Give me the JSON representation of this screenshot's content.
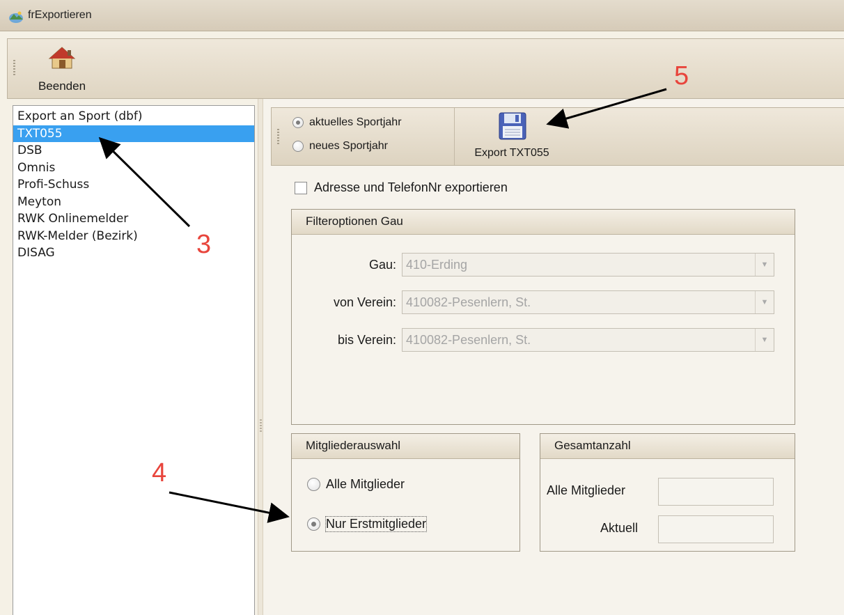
{
  "window": {
    "title": "frExportieren"
  },
  "toolbar": {
    "home_label": "Beenden"
  },
  "export_list": {
    "items": [
      {
        "label": "Export an Sport (dbf)",
        "selected": false
      },
      {
        "label": "TXT055",
        "selected": true
      },
      {
        "label": "DSB",
        "selected": false
      },
      {
        "label": "Omnis",
        "selected": false
      },
      {
        "label": "Profi-Schuss",
        "selected": false
      },
      {
        "label": "Meyton",
        "selected": false
      },
      {
        "label": "RWK Onlinemelder",
        "selected": false
      },
      {
        "label": "RWK-Melder (Bezirk)",
        "selected": false
      },
      {
        "label": "DISAG",
        "selected": false
      }
    ]
  },
  "sportjahr": {
    "current_label": "aktuelles Sportjahr",
    "new_label": "neues Sportjahr",
    "selected": "current"
  },
  "export_button": {
    "label": "Export TXT055"
  },
  "address_checkbox": {
    "label": "Adresse und TelefonNr exportieren",
    "checked": false
  },
  "filter_group": {
    "title": "Filteroptionen Gau",
    "gau_label": "Gau:",
    "gau_value": "410-Erding",
    "von_label": "von Verein:",
    "von_value": "410082-Pesenlern, St.",
    "bis_label": "bis Verein:",
    "bis_value": "410082-Pesenlern, St."
  },
  "member_group": {
    "title": "Mitgliederauswahl",
    "all_label": "Alle Mitglieder",
    "first_label": "Nur Erstmitglieder",
    "selected": "first"
  },
  "count_group": {
    "title": "Gesamtanzahl",
    "all_label": "Alle Mitglieder",
    "all_value": "",
    "current_label": "Aktuell",
    "current_value": ""
  },
  "annotations": {
    "n3": "3",
    "n4": "4",
    "n5": "5",
    "color": "#e8453c"
  }
}
